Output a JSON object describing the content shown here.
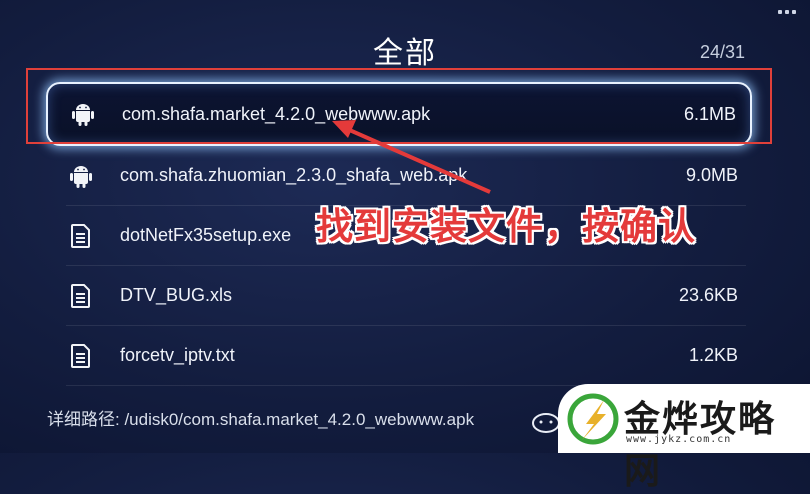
{
  "header": {
    "title": "全部",
    "counter": "24/31"
  },
  "files": [
    {
      "name": "com.shafa.market_4.2.0_webwww.apk",
      "size": "6.1MB",
      "icon": "android-icon",
      "selected": true
    },
    {
      "name": "com.shafa.zhuomian_2.3.0_shafa_web.apk",
      "size": "9.0MB",
      "icon": "android-icon",
      "selected": false
    },
    {
      "name": "dotNetFx35setup.exe",
      "size": "",
      "icon": "document-icon",
      "selected": false
    },
    {
      "name": "DTV_BUG.xls",
      "size": "23.6KB",
      "icon": "document-icon",
      "selected": false
    },
    {
      "name": "forcetv_iptv.txt",
      "size": "1.2KB",
      "icon": "document-icon",
      "selected": false
    }
  ],
  "path_bar": {
    "text": "详细路径: /udisk0/com.shafa.market_4.2.0_webwww.apk"
  },
  "annotation": {
    "text": "找到安装文件，按确认",
    "color": "#e43a3a"
  },
  "watermark": {
    "brand": "金烨攻略网",
    "url": "www.jykz.com.cn"
  },
  "colors": {
    "background": "#131d3f",
    "selection_glow": "#9fcaff",
    "highlight_box": "#e0403a"
  }
}
